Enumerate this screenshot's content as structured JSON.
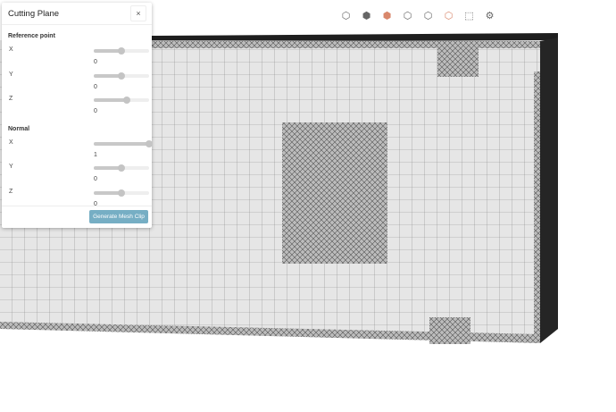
{
  "panel": {
    "title": "Cutting Plane",
    "close": "×",
    "reference_label": "Reference point",
    "reference": [
      {
        "axis": "X",
        "value": "0",
        "slider": 0.5
      },
      {
        "axis": "Y",
        "value": "0",
        "slider": 0.5
      },
      {
        "axis": "Z",
        "value": "0",
        "slider": 0.6
      }
    ],
    "normal_label": "Normal",
    "normal": [
      {
        "axis": "X",
        "value": "1",
        "slider": 1.0
      },
      {
        "axis": "Y",
        "value": "0",
        "slider": 0.5
      },
      {
        "axis": "Z",
        "value": "0",
        "slider": 0.5
      }
    ],
    "generate": "Generate Mesh Clip"
  },
  "toolbar": [
    {
      "icon": "view-cube-icon"
    },
    {
      "icon": "solid-cube-icon"
    },
    {
      "icon": "orange-cube-icon"
    },
    {
      "icon": "half-cube-icon"
    },
    {
      "icon": "dotted-cube-icon"
    },
    {
      "icon": "orange-outline-cube-icon"
    },
    {
      "icon": "box-select-icon"
    },
    {
      "icon": "settings-cube-icon"
    }
  ]
}
